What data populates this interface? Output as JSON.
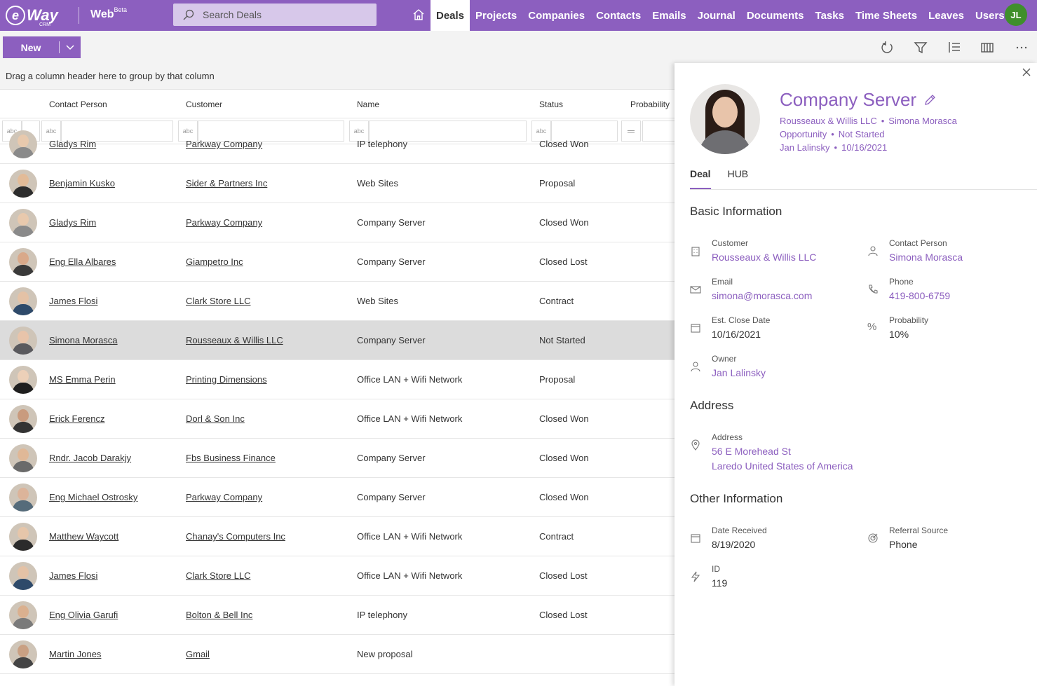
{
  "app": {
    "logo_e": "e",
    "logo_way": "Way",
    "logo_crm": "CRM",
    "web": "Web",
    "beta": "Beta",
    "search_placeholder": "Search Deals",
    "user_initials": "JL"
  },
  "nav": [
    "Deals",
    "Projects",
    "Companies",
    "Contacts",
    "Emails",
    "Journal",
    "Documents",
    "Tasks",
    "Time Sheets",
    "Leaves",
    "Users"
  ],
  "toolbar": {
    "new_label": "New"
  },
  "grid": {
    "group_hint": "Drag a column header here to group by that column",
    "columns": [
      "Contact Person",
      "Customer",
      "Name",
      "Status",
      "Probability"
    ],
    "rows": [
      {
        "contact": "Gladys Rim",
        "customer": "Parkway Company",
        "name": "IP telephony",
        "status": "Closed Won"
      },
      {
        "contact": "Benjamin Kusko",
        "customer": "Sider & Partners Inc",
        "name": "Web Sites",
        "status": "Proposal"
      },
      {
        "contact": "Gladys Rim",
        "customer": "Parkway Company",
        "name": "Company Server",
        "status": "Closed Won"
      },
      {
        "contact": "Eng Ella Albares",
        "customer": "Giampetro Inc",
        "name": "Company Server",
        "status": "Closed Lost"
      },
      {
        "contact": "James Flosi",
        "customer": "Clark Store LLC",
        "name": "Web Sites",
        "status": "Contract"
      },
      {
        "contact": "Simona Morasca",
        "customer": "Rousseaux & Willis LLC",
        "name": "Company Server",
        "status": "Not Started"
      },
      {
        "contact": "MS Emma Perin",
        "customer": "Printing Dimensions",
        "name": "Office LAN + Wifi Network",
        "status": "Proposal"
      },
      {
        "contact": "Erick Ferencz",
        "customer": "Dorl & Son Inc",
        "name": "Office LAN + Wifi Network",
        "status": "Closed Won"
      },
      {
        "contact": "Rndr. Jacob Darakjy",
        "customer": "Fbs Business Finance",
        "name": "Company Server",
        "status": "Closed Won"
      },
      {
        "contact": "Eng Michael Ostrosky",
        "customer": "Parkway Company",
        "name": "Company Server",
        "status": "Closed Won"
      },
      {
        "contact": "Matthew Waycott",
        "customer": "Chanay's Computers Inc",
        "name": "Office LAN + Wifi Network",
        "status": "Contract"
      },
      {
        "contact": "James Flosi",
        "customer": "Clark Store LLC",
        "name": "Office LAN + Wifi Network",
        "status": "Closed Lost"
      },
      {
        "contact": "Eng Olivia Garufi",
        "customer": "Bolton & Bell Inc",
        "name": "IP telephony",
        "status": "Closed Lost"
      },
      {
        "contact": "Martin Jones",
        "customer": "Gmail",
        "name": "New proposal",
        "status": ""
      }
    ]
  },
  "detail": {
    "title": "Company Server",
    "customer": "Rousseaux & Willis LLC",
    "contact": "Simona Morasca",
    "type": "Opportunity",
    "status": "Not Started",
    "owner": "Jan Lalinsky",
    "date": "10/16/2021",
    "tabs": [
      "Deal",
      "HUB"
    ],
    "sections": {
      "basic": "Basic Information",
      "address": "Address",
      "other": "Other Information"
    },
    "fields": {
      "customer": {
        "label": "Customer",
        "value": "Rousseaux & Willis LLC"
      },
      "contact": {
        "label": "Contact Person",
        "value": "Simona Morasca"
      },
      "email": {
        "label": "Email",
        "value": "simona@morasca.com"
      },
      "phone": {
        "label": "Phone",
        "value": "419-800-6759"
      },
      "close_date": {
        "label": "Est. Close Date",
        "value": "10/16/2021"
      },
      "probability": {
        "label": "Probability",
        "value": "10%"
      },
      "owner": {
        "label": "Owner",
        "value": "Jan Lalinsky"
      },
      "address": {
        "label": "Address",
        "line1": "56 E Morehead St",
        "line2": "Laredo United States of America"
      },
      "date_received": {
        "label": "Date Received",
        "value": "8/19/2020"
      },
      "referral": {
        "label": "Referral Source",
        "value": "Phone"
      },
      "id": {
        "label": "ID",
        "value": "119"
      }
    }
  },
  "colors": {
    "accent": "#8c5fbf",
    "avatar_green": "#3f8f2b"
  }
}
